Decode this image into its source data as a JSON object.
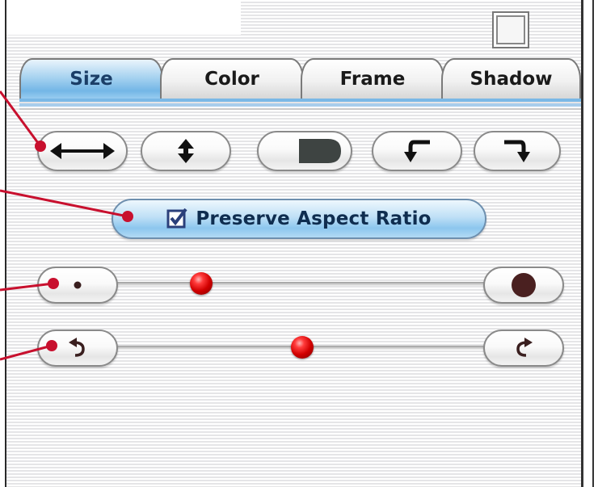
{
  "tabs": [
    {
      "label": "Size",
      "selected": true
    },
    {
      "label": "Color",
      "selected": false
    },
    {
      "label": "Frame",
      "selected": false
    },
    {
      "label": "Shadow",
      "selected": false
    }
  ],
  "toolbar": {
    "buttons": [
      {
        "icon": "horizontal-arrows-icon"
      },
      {
        "icon": "vertical-arrows-icon"
      },
      {
        "icon": "dark-rounded-square-icon"
      },
      {
        "icon": "rotate-left-arrow-icon"
      },
      {
        "icon": "rotate-right-arrow-icon"
      }
    ]
  },
  "aspect": {
    "label": "Preserve Aspect Ratio",
    "checked": true
  },
  "size_slider": {
    "min_icon": "small-dot-icon",
    "max_icon": "large-dot-icon",
    "value_fraction": 0.22
  },
  "rotation_slider": {
    "min_icon": "rotate-ccw-icon",
    "max_icon": "rotate-cw-icon",
    "value_fraction": 0.5
  },
  "colors": {
    "tab_selected": "#8cc6ee",
    "accent_rule": "#7ab8e6",
    "callout": "#c8102e",
    "knob": "#d10000"
  }
}
